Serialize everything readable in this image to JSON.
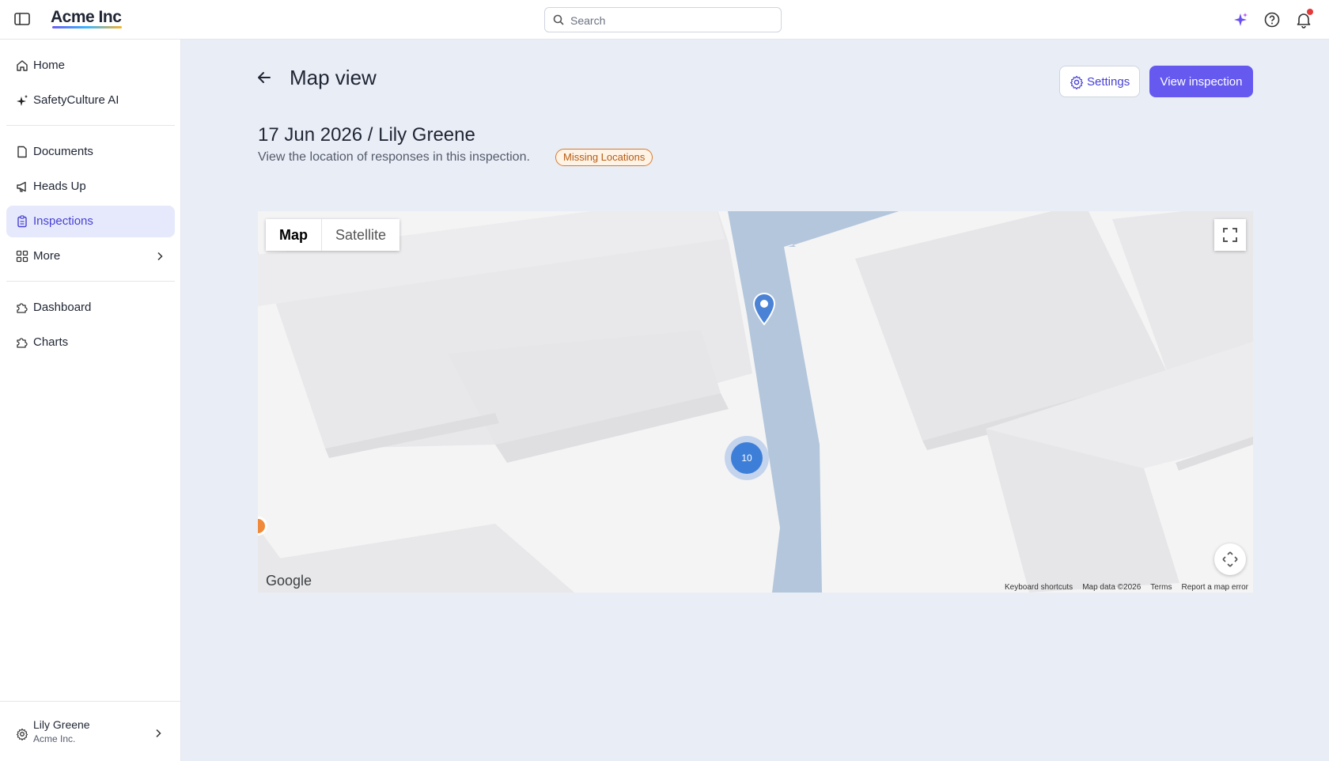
{
  "app": {
    "brand": "Acme Inc",
    "colors": {
      "accent": "#6559f0",
      "nav_active_bg": "#e6e9fb",
      "badge_border": "#d97a2b",
      "road": "#b3c6db",
      "cluster": "#3d7fd8",
      "notification": "#e33a3a"
    }
  },
  "topbar": {
    "search_placeholder": "Search",
    "icons": [
      "sidebar-toggle-icon",
      "search-icon",
      "sparkle-icon",
      "help-icon",
      "bell-icon"
    ]
  },
  "sidebar": {
    "items": [
      {
        "label": "Home",
        "icon": "home-icon"
      },
      {
        "label": "SafetyCulture AI",
        "icon": "sparkle-icon"
      },
      {
        "label": "Documents",
        "icon": "document-icon"
      },
      {
        "label": "Heads Up",
        "icon": "megaphone-icon"
      },
      {
        "label": "Inspections",
        "icon": "clipboard-icon",
        "active": true
      },
      {
        "label": "More",
        "icon": "grid-icon"
      },
      {
        "label": "Dashboard",
        "icon": "puzzle-icon"
      },
      {
        "label": "Charts",
        "icon": "puzzle-icon"
      }
    ],
    "user": {
      "name": "Lily Greene",
      "org": "Acme Inc."
    }
  },
  "page": {
    "title": "Map view",
    "settings_label": "Settings",
    "view_inspection_label": "View inspection",
    "inspection_title": "17 Jun 2026 / Lily Greene",
    "subtitle": "View the location of responses in this inspection.",
    "badge": "Missing Locations"
  },
  "map": {
    "type_options": [
      {
        "label": "Map",
        "selected": true
      },
      {
        "label": "Satellite",
        "selected": false
      }
    ],
    "cluster_count": "10",
    "provider": "Google",
    "attribution": {
      "keyboard": "Keyboard shortcuts",
      "data": "Map data ©2026",
      "terms": "Terms",
      "report": "Report a map error"
    }
  }
}
